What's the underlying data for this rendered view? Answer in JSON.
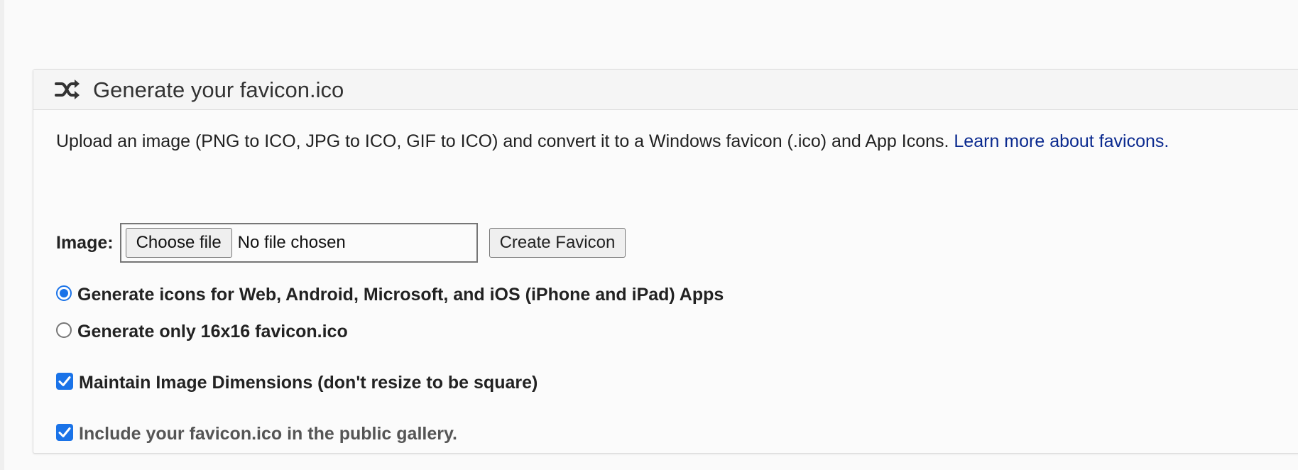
{
  "panel": {
    "title": "Generate your favicon.ico",
    "icon": "shuffle-icon"
  },
  "intro": {
    "text": "Upload an image (PNG to ICO, JPG to ICO, GIF to ICO) and convert it to a Windows favicon (.ico) and App Icons. ",
    "link_text": "Learn more about favicons."
  },
  "form": {
    "image_label": "Image:",
    "choose_file_label": "Choose file",
    "file_status": "No file chosen",
    "create_button_label": "Create Favicon"
  },
  "options": {
    "web_apps": {
      "label": "Generate icons for Web, Android, Microsoft, and iOS (iPhone and iPad) Apps",
      "selected": true
    },
    "only_16": {
      "label": "Generate only 16x16 favicon.ico",
      "selected": false
    },
    "maintain_dimensions": {
      "label": "Maintain Image Dimensions (don't resize to be square)",
      "checked": true
    },
    "public_gallery": {
      "label": "Include your favicon.ico in the public gallery.",
      "checked": true
    }
  },
  "colors": {
    "accent": "#1a73e8",
    "link": "#0b2a8f",
    "text": "#222222"
  }
}
